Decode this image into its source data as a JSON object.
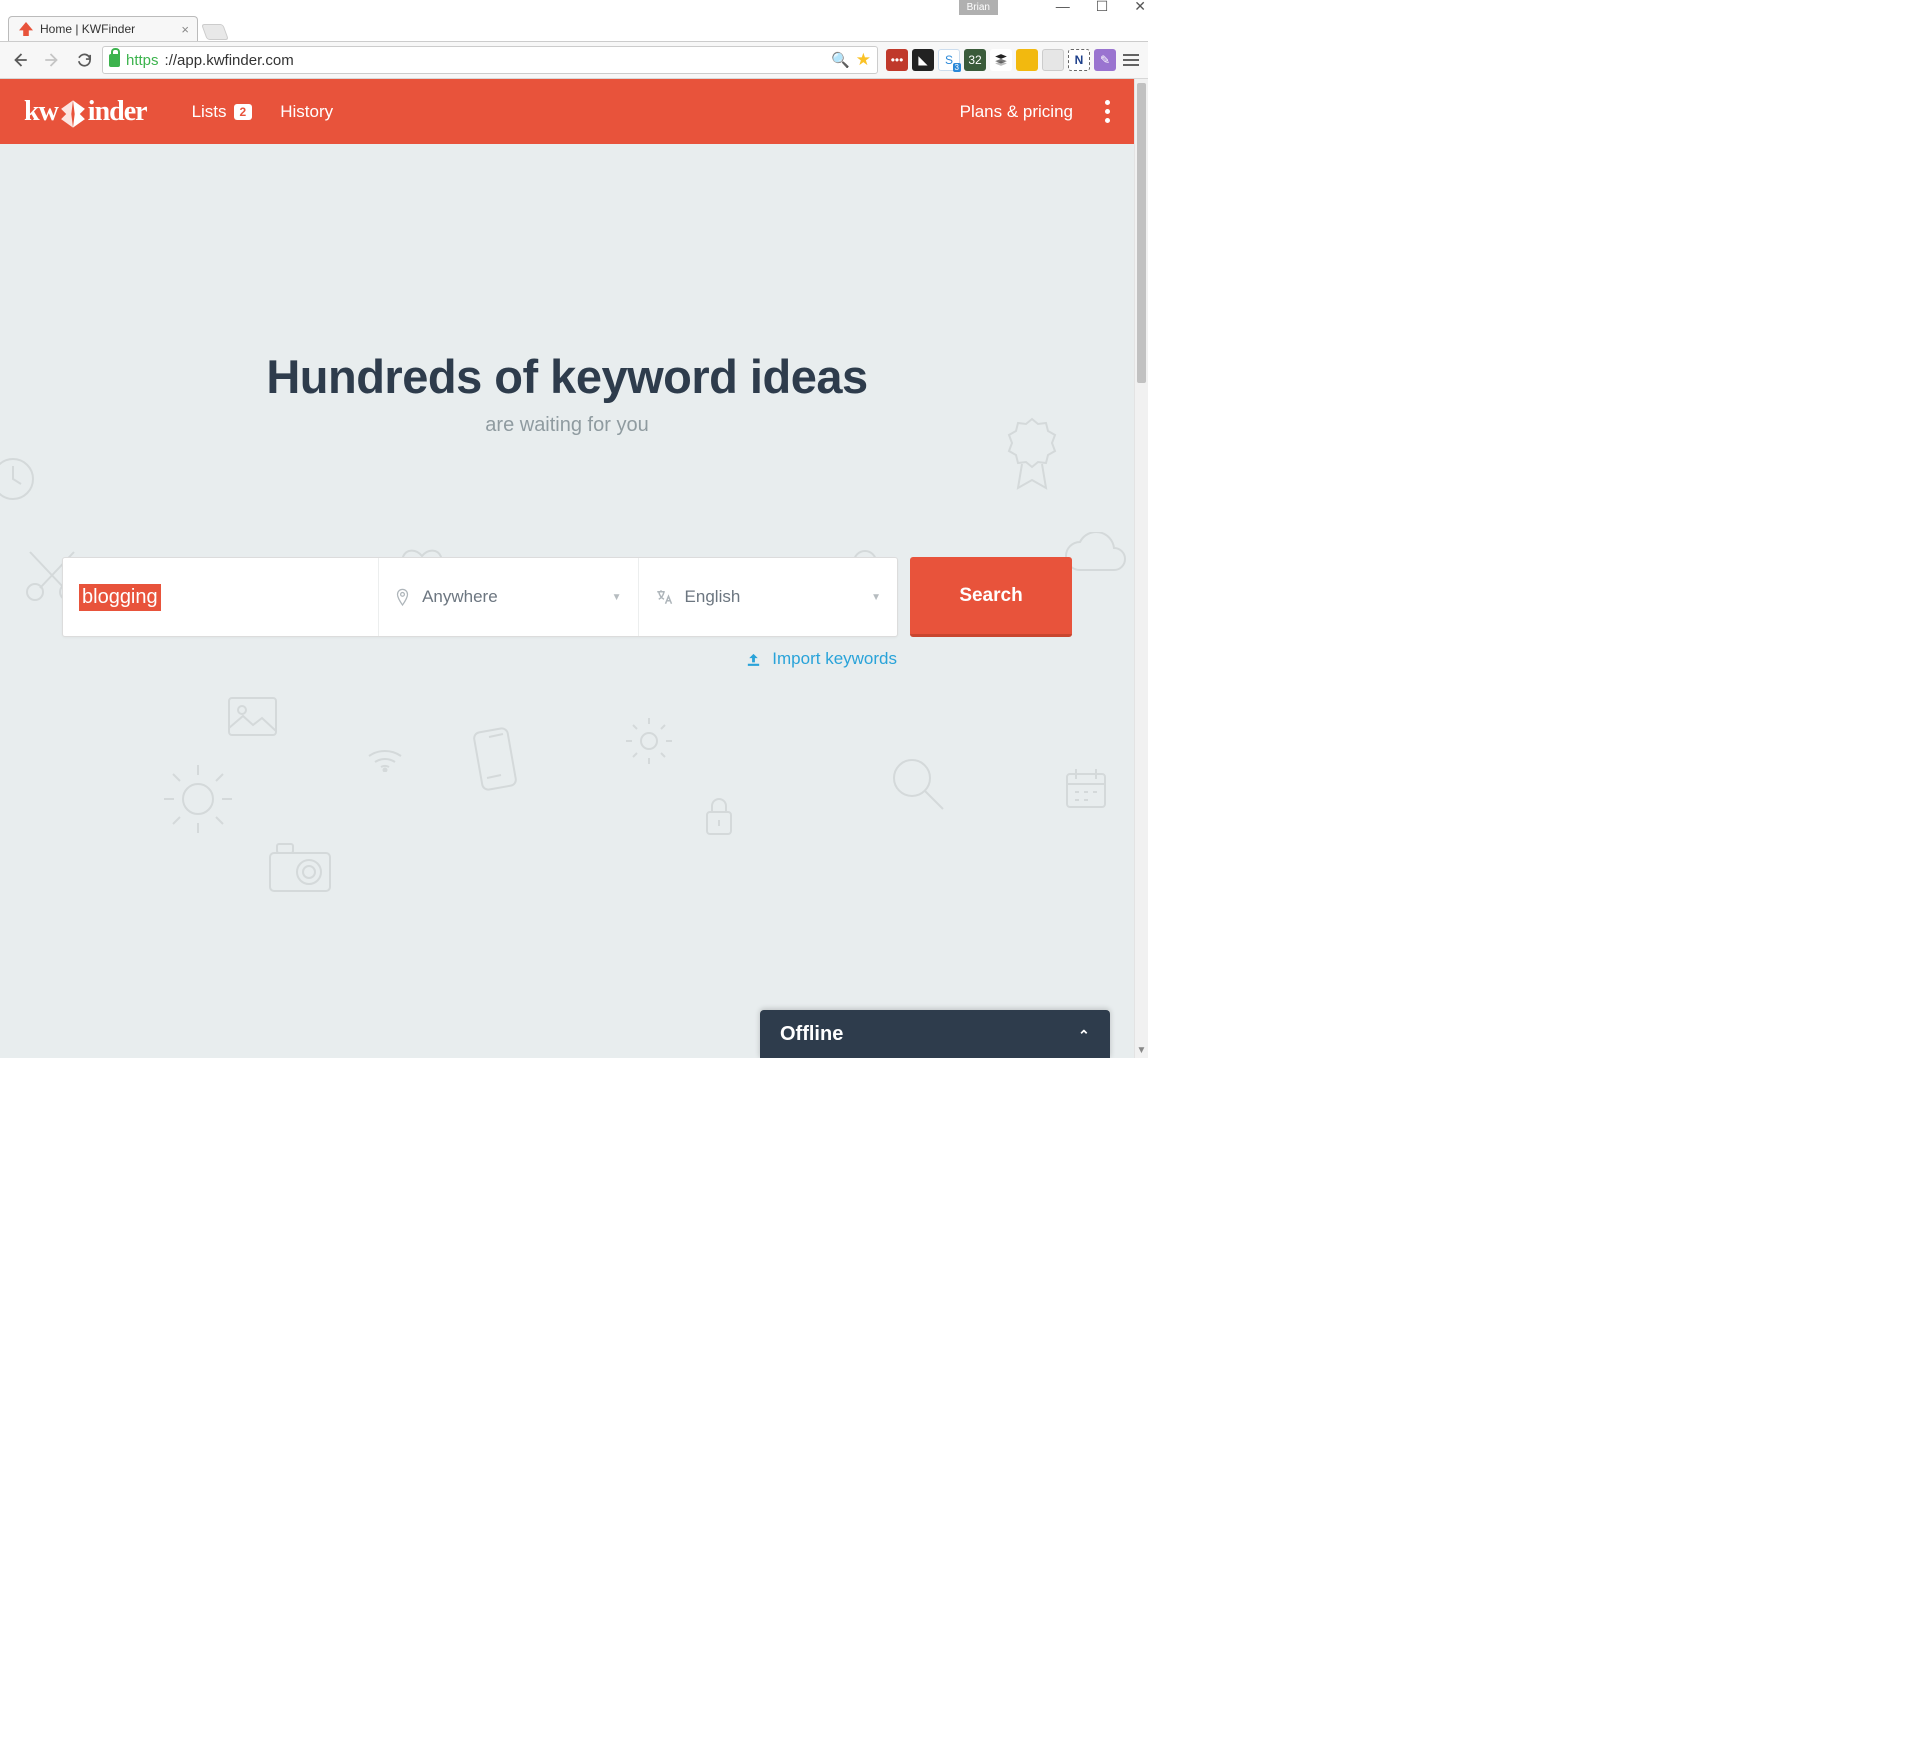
{
  "window": {
    "user_badge": "Brian"
  },
  "browser": {
    "tab_title": "Home | KWFinder",
    "url_scheme": "https",
    "url_rest": "://app.kwfinder.com"
  },
  "header": {
    "logo_pre": "kw",
    "logo_post": "inder",
    "nav": {
      "lists_label": "Lists",
      "lists_count": "2",
      "history_label": "History"
    },
    "plans_label": "Plans & pricing"
  },
  "hero": {
    "title": "Hundreds of keyword ideas",
    "subtitle": "are waiting for you"
  },
  "search": {
    "keyword_value": "blogging",
    "location_value": "Anywhere",
    "language_value": "English",
    "button_label": "Search",
    "import_label": "Import keywords"
  },
  "chat": {
    "status": "Offline"
  }
}
